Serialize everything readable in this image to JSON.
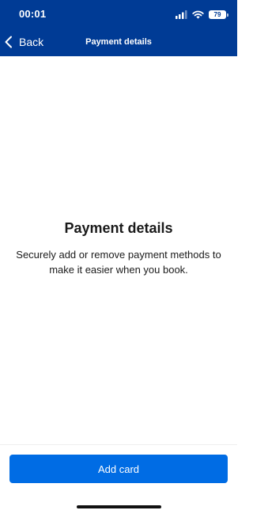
{
  "status_bar": {
    "time": "00:01",
    "battery_level": "79",
    "icons": [
      "signal-icon",
      "wifi-icon",
      "battery-icon"
    ]
  },
  "nav": {
    "back_label": "Back",
    "title": "Payment details"
  },
  "main": {
    "heading": "Payment details",
    "description": "Securely add or remove payment methods to make it easier when you book."
  },
  "footer": {
    "add_card_label": "Add card"
  },
  "colors": {
    "header_background": "#003b95",
    "primary_button": "#006ce4",
    "text": "#1a1a1a",
    "background": "#ffffff"
  }
}
